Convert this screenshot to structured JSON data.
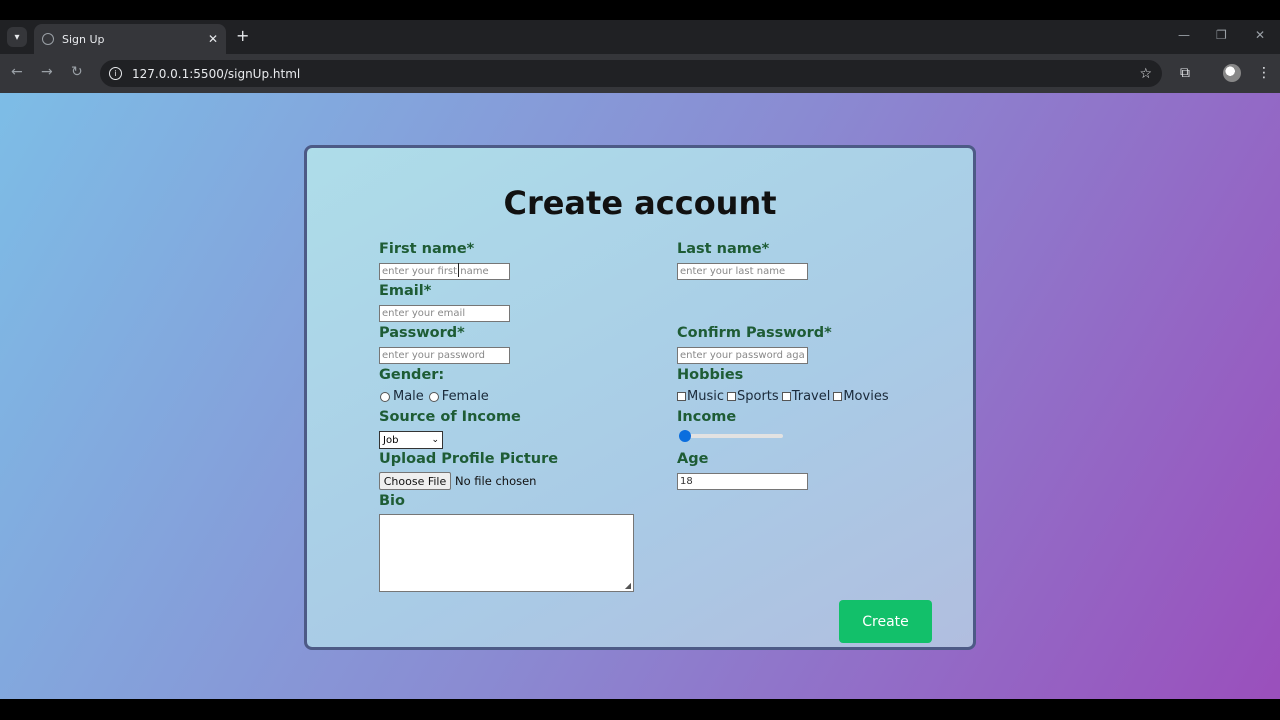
{
  "browser": {
    "tab_title": "Sign Up",
    "url": "127.0.0.1:5500/signUp.html"
  },
  "form": {
    "title": "Create account",
    "first_name_label": "First name*",
    "first_name_placeholder": "enter your first name",
    "last_name_label": "Last name*",
    "last_name_placeholder": "enter your last name",
    "email_label": "Email*",
    "email_placeholder": "enter your email",
    "password_label": "Password*",
    "password_placeholder": "enter your password",
    "confirm_password_label": "Confirm Password*",
    "confirm_password_placeholder": "enter your password again",
    "gender_label": "Gender:",
    "gender_options": [
      "Male",
      "Female"
    ],
    "hobbies_label": "Hobbies",
    "hobby_options": [
      "Music",
      "Sports",
      "Travel",
      "Movies"
    ],
    "income_source_label": "Source of Income",
    "income_source_value": "Job",
    "income_label": "Income",
    "income_value_fraction": 0,
    "upload_label": "Upload Profile Picture",
    "choose_file_label": "Choose File",
    "file_status": "No file chosen",
    "age_label": "Age",
    "age_value": "18",
    "bio_label": "Bio",
    "create_button": "Create"
  },
  "colors": {
    "label": "#1e5c35",
    "create_button": "#12c06a",
    "slider_thumb": "#0a6ede"
  }
}
